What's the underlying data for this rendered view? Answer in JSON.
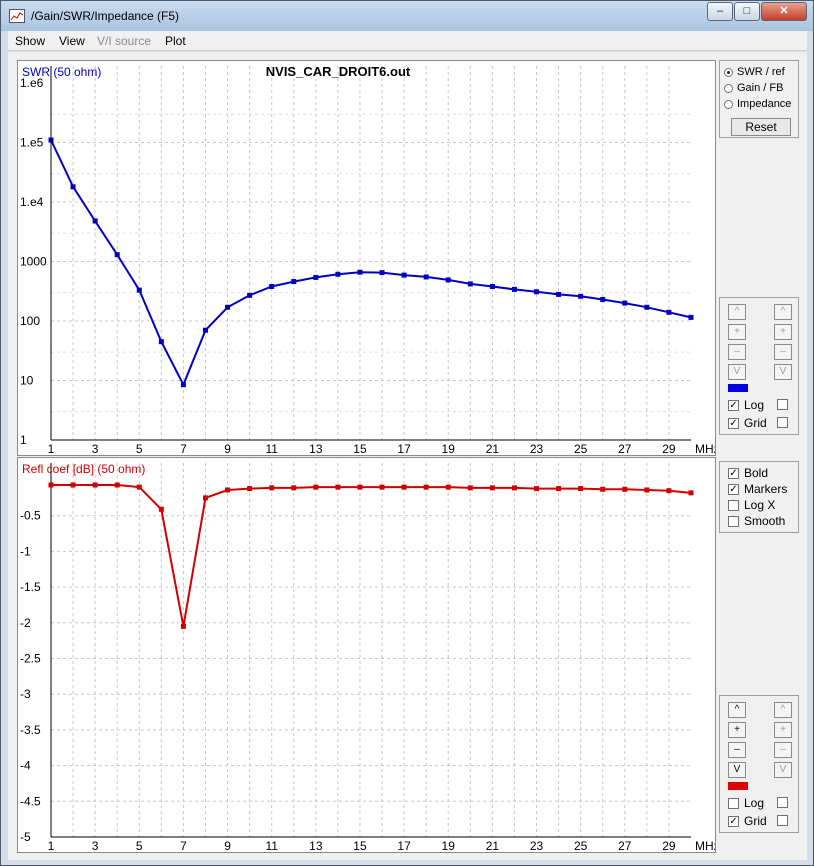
{
  "window": {
    "title": "/Gain/SWR/Impedance (F5)",
    "controls": {
      "minimize": "–",
      "maximize": "□",
      "close": "✕"
    }
  },
  "menu": {
    "show": "Show",
    "view": "View",
    "vi_source": "V/I source",
    "plot": "Plot"
  },
  "top_panel": {
    "radios": [
      {
        "label": "SWR / ref",
        "selected": true
      },
      {
        "label": "Gain / FB",
        "selected": false
      },
      {
        "label": "Impedance",
        "selected": false
      }
    ],
    "reset_label": "Reset",
    "scale_buttons_left": [
      "^",
      "+",
      "–",
      "V"
    ],
    "scale_buttons_right": [
      "^",
      "+",
      "–",
      "V"
    ],
    "color_swatch": "#0000e0",
    "log_label": "Log",
    "log_checked": true,
    "grid_label": "Grid",
    "grid_checked": true
  },
  "options_panel": {
    "bold_label": "Bold",
    "bold_checked": true,
    "markers_label": "Markers",
    "markers_checked": true,
    "logx_label": "Log X",
    "logx_checked": false,
    "smooth_label": "Smooth",
    "smooth_checked": false
  },
  "bottom_panel": {
    "scale_buttons_left": [
      "^",
      "+",
      "–",
      "V"
    ],
    "scale_buttons_right": [
      "^",
      "+",
      "–",
      "V"
    ],
    "color_swatch": "#e00000",
    "log_label": "Log",
    "log_checked": false,
    "grid_label": "Grid",
    "grid_checked": true
  },
  "chart_data": [
    {
      "type": "line",
      "title": "NVIS_CAR_DROIT6.out",
      "ylabel": "SWR (50 ohm)",
      "xlabel": "MHz",
      "x_tick_labels": [
        "1",
        "3",
        "5",
        "7",
        "9",
        "11",
        "13",
        "15",
        "17",
        "19",
        "21",
        "23",
        "25",
        "27",
        "29",
        "MHz"
      ],
      "y_tick_labels": [
        "1.e6",
        "1.e5",
        "1.e4",
        "1000",
        "100",
        "10",
        "1"
      ],
      "xlim": [
        1,
        30
      ],
      "ylim": [
        1,
        1000000
      ],
      "y_scale": "log",
      "grid": true,
      "color": "#0000c0",
      "series": [
        {
          "x": [
            1,
            2,
            3,
            4,
            5,
            6,
            7,
            8,
            9,
            10,
            11,
            12,
            13,
            14,
            15,
            16,
            17,
            18,
            19,
            20,
            21,
            22,
            23,
            24,
            25,
            26,
            27,
            28,
            29,
            30
          ],
          "values": [
            110000,
            18000,
            4800,
            1300,
            330,
            45,
            8.5,
            70,
            170,
            270,
            380,
            460,
            540,
            610,
            660,
            650,
            590,
            550,
            490,
            420,
            380,
            340,
            310,
            280,
            260,
            230,
            200,
            170,
            140,
            115
          ]
        }
      ]
    },
    {
      "type": "line",
      "ylabel": "Refl coef [dB] (50 ohm)",
      "xlabel": "MHz",
      "x_tick_labels": [
        "1",
        "3",
        "5",
        "7",
        "9",
        "11",
        "13",
        "15",
        "17",
        "19",
        "21",
        "23",
        "25",
        "27",
        "29",
        "MHz"
      ],
      "y_tick_labels": [
        "-0.5",
        "-1",
        "-1.5",
        "-2",
        "-2.5",
        "-3",
        "-3.5",
        "-4",
        "-4.5",
        "-5"
      ],
      "xlim": [
        1,
        30
      ],
      "ylim": [
        -5,
        0
      ],
      "grid": true,
      "color": "#d00000",
      "series": [
        {
          "x": [
            1,
            2,
            3,
            4,
            5,
            6,
            7,
            8,
            9,
            10,
            11,
            12,
            13,
            14,
            15,
            16,
            17,
            18,
            19,
            20,
            21,
            22,
            23,
            24,
            25,
            26,
            27,
            28,
            29,
            30
          ],
          "values": [
            -0.07,
            -0.07,
            -0.07,
            -0.07,
            -0.1,
            -0.41,
            -2.05,
            -0.25,
            -0.14,
            -0.12,
            -0.11,
            -0.11,
            -0.1,
            -0.1,
            -0.1,
            -0.1,
            -0.1,
            -0.1,
            -0.1,
            -0.11,
            -0.11,
            -0.11,
            -0.12,
            -0.12,
            -0.12,
            -0.13,
            -0.13,
            -0.14,
            -0.15,
            -0.18
          ]
        }
      ]
    }
  ]
}
